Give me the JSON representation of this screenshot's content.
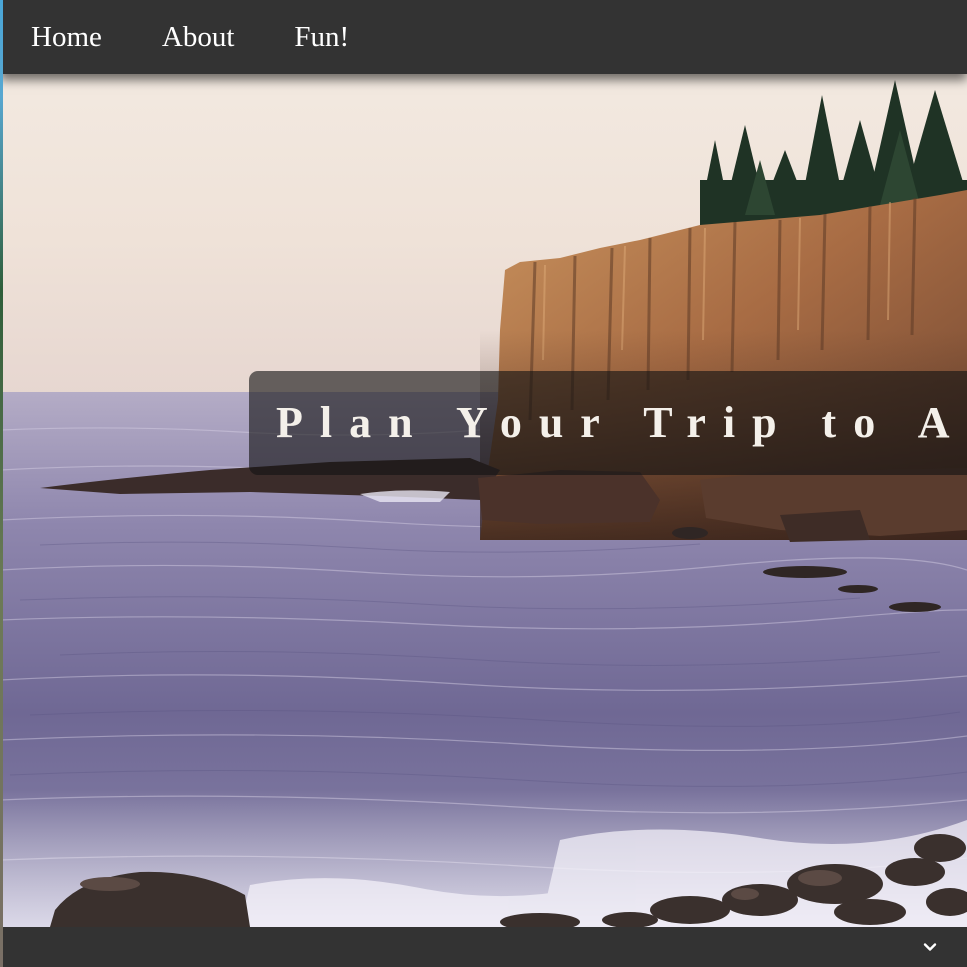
{
  "nav": {
    "items": [
      {
        "label": "Home"
      },
      {
        "label": "About"
      },
      {
        "label": "Fun!"
      }
    ]
  },
  "hero": {
    "scene": "rocky-coast-cliff-sunrise"
  },
  "banner": {
    "title": "Plan Your Trip to Arc"
  },
  "footer": {
    "expand_icon": "chevron-down-icon"
  },
  "colors": {
    "nav_bg": "#333333",
    "nav_text": "#ffffff",
    "banner_bg": "rgba(20,20,20,0.62)",
    "banner_text": "#f4f0ea"
  }
}
